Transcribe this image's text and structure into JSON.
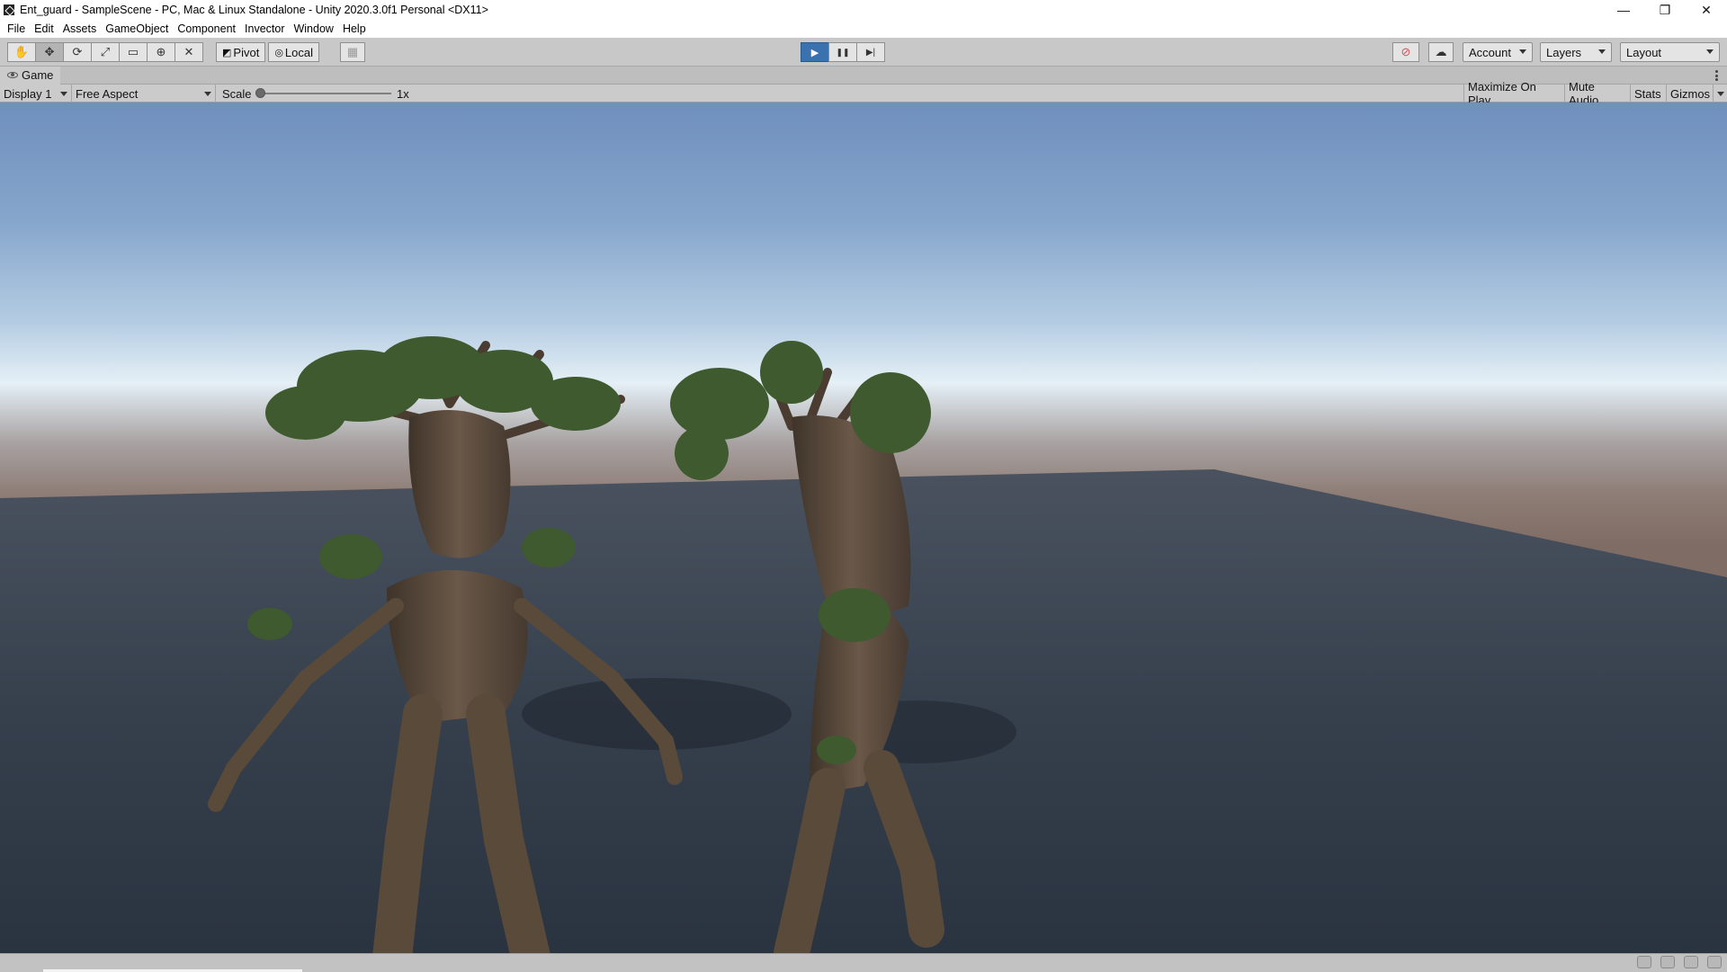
{
  "window": {
    "title": "Ent_guard - SampleScene - PC, Mac & Linux Standalone - Unity 2020.3.0f1 Personal <DX11>",
    "controls": {
      "minimize": "—",
      "restore": "❐",
      "close": "✕"
    }
  },
  "menu": [
    "File",
    "Edit",
    "Assets",
    "GameObject",
    "Component",
    "Invector",
    "Window",
    "Help"
  ],
  "toolbar": {
    "transform_tools": [
      {
        "name": "hand-tool",
        "icon": "✋"
      },
      {
        "name": "move-tool",
        "icon": "✥"
      },
      {
        "name": "rotate-tool",
        "icon": "⟳"
      },
      {
        "name": "scale-tool",
        "icon": "⤢"
      },
      {
        "name": "rect-tool",
        "icon": "▭"
      },
      {
        "name": "transform-tool",
        "icon": "⊕"
      },
      {
        "name": "custom-tool",
        "icon": "✕"
      }
    ],
    "pivot_label": "Pivot",
    "local_label": "Local",
    "grid_icon": "▦",
    "play_icon": "▶",
    "pause_icon": "❚❚",
    "step_icon": "▶|",
    "collab_icon": "⊘",
    "cloud_icon": "☁",
    "account_label": "Account",
    "layers_label": "Layers",
    "layout_label": "Layout"
  },
  "game_tab": {
    "label": "Game"
  },
  "game_bar": {
    "display": "Display 1",
    "aspect": "Free Aspect",
    "scale_label": "Scale",
    "scale_value": "1x",
    "maximize": "Maximize On Play",
    "mute": "Mute Audio",
    "stats": "Stats",
    "gizmos": "Gizmos"
  },
  "colors": {
    "sky_top": "#6f8fbd",
    "horizon": "#e5f0f6",
    "ground_plane": "#3a4452",
    "terrain": "#7f6d65",
    "bark": "#5a4a3a",
    "foliage": "#3f5a2e",
    "play_active": "#3a72b0"
  }
}
